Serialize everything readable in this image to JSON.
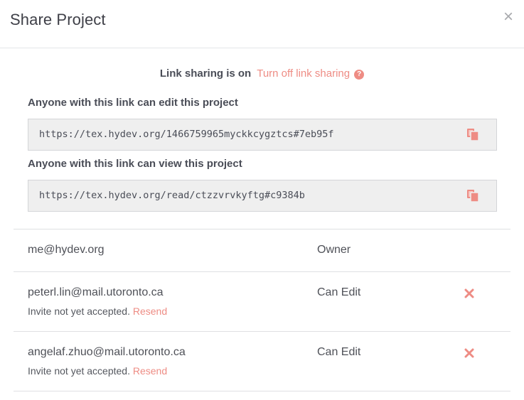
{
  "header": {
    "title": "Share Project",
    "close_glyph": "×"
  },
  "link_sharing": {
    "status": "Link sharing is on",
    "toggle_label": "Turn off link sharing",
    "help_glyph": "?",
    "accent_color": "#ee8c84"
  },
  "edit_link": {
    "label": "Anyone with this link can edit this project",
    "url": "https://tex.hydev.org/1466759965myckkcygztcs#7eb95f",
    "copy_icon": "copy-icon"
  },
  "view_link": {
    "label": "Anyone with this link can view this project",
    "url": "https://tex.hydev.org/read/ctzzvrvkyftg#c9384b",
    "copy_icon": "copy-icon"
  },
  "members": [
    {
      "email": "me@hydev.org",
      "role": "Owner"
    },
    {
      "email": "peterl.lin@mail.utoronto.ca",
      "role": "Can Edit",
      "note": "Invite not yet accepted.",
      "action": "Resend",
      "remove_icon": "remove-icon"
    },
    {
      "email": "angelaf.zhuo@mail.utoronto.ca",
      "role": "Can Edit",
      "note": "Invite not yet accepted.",
      "action": "Resend",
      "remove_icon": "remove-icon"
    }
  ]
}
